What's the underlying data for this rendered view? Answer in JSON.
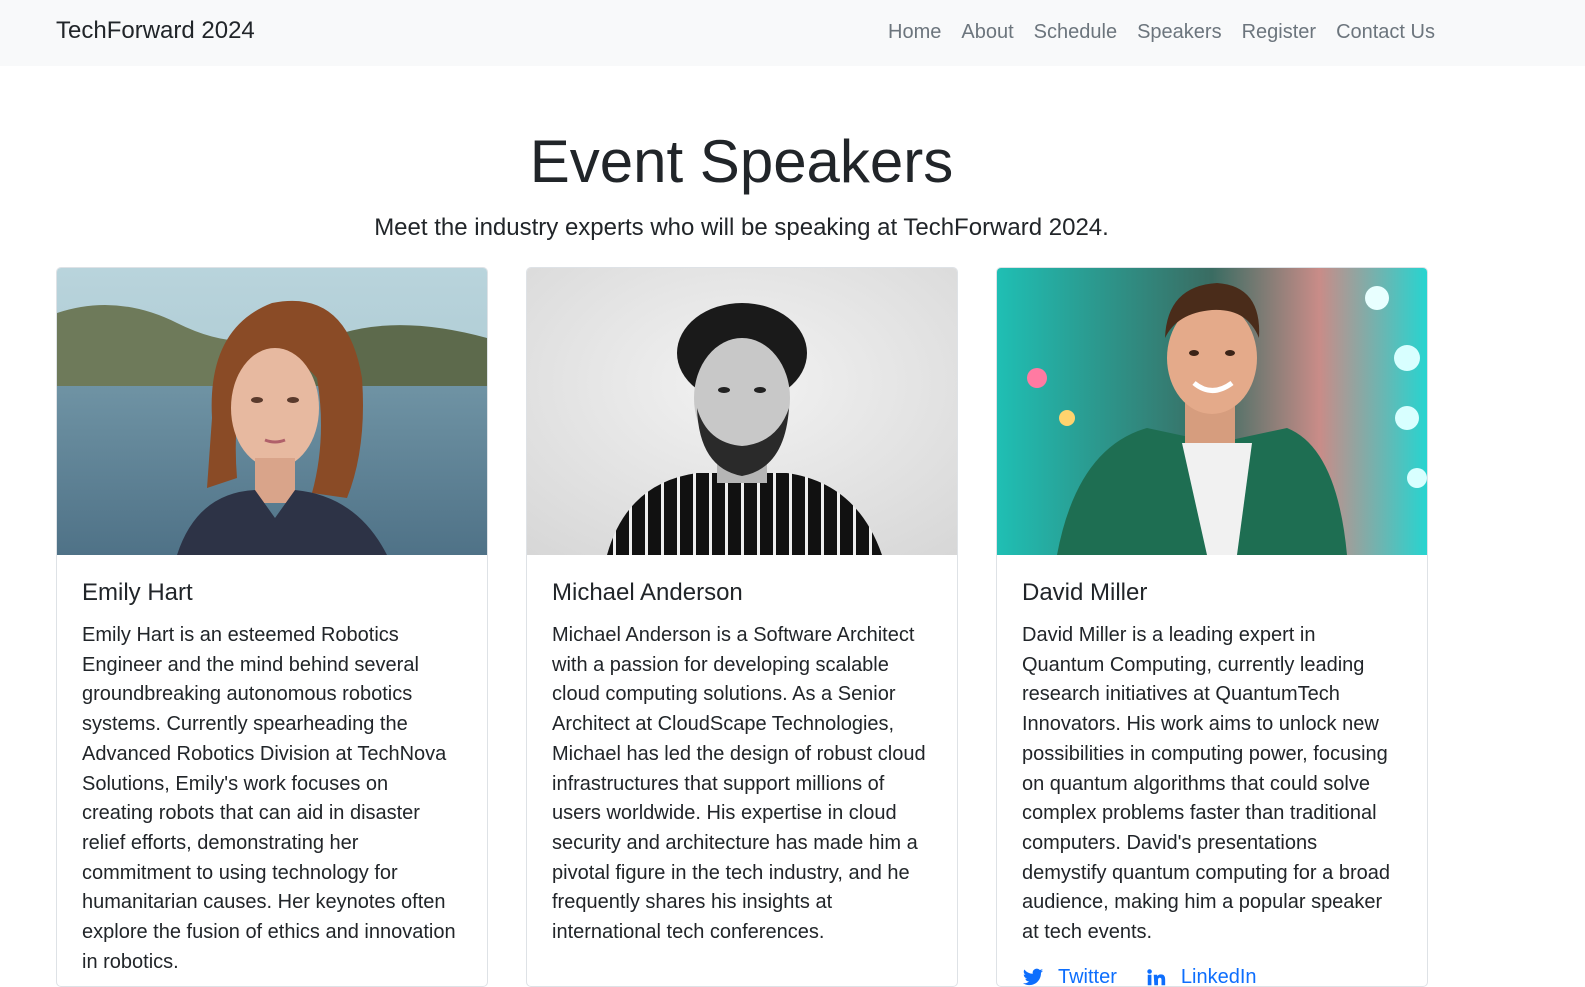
{
  "navbar": {
    "brand": "TechForward 2024",
    "links": [
      "Home",
      "About",
      "Schedule",
      "Speakers",
      "Register",
      "Contact Us"
    ]
  },
  "header": {
    "title": "Event Speakers",
    "subtitle": "Meet the industry experts who will be speaking at TechForward 2024."
  },
  "speakers": [
    {
      "name": "Emily Hart",
      "bio": "Emily Hart is an esteemed Robotics Engineer and the mind behind several groundbreaking autonomous robotics systems. Currently spearheading the Advanced Robotics Division at TechNova Solutions, Emily's work focuses on creating robots that can aid in disaster relief efforts, demonstrating her commitment to using technology for humanitarian causes. Her keynotes often explore the fusion of ethics and innovation in robotics."
    },
    {
      "name": "Michael Anderson",
      "bio": "Michael Anderson is a Software Architect with a passion for developing scalable cloud computing solutions. As a Senior Architect at CloudScape Technologies, Michael has led the design of robust cloud infrastructures that support millions of users worldwide. His expertise in cloud security and architecture has made him a pivotal figure in the tech industry, and he frequently shares his insights at international tech conferences."
    },
    {
      "name": "David Miller",
      "bio": "David Miller is a leading expert in Quantum Computing, currently leading research initiatives at QuantumTech Innovators. His work aims to unlock new possibilities in computing power, focusing on quantum algorithms that could solve complex problems faster than traditional computers. David's presentations demystify quantum computing for a broad audience, making him a popular speaker at tech events.",
      "social": {
        "twitter": "Twitter",
        "linkedin": "LinkedIn"
      }
    }
  ]
}
